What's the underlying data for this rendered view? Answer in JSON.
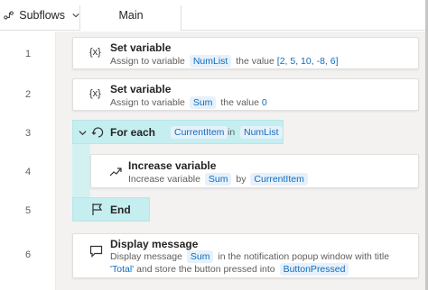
{
  "tabs": {
    "subflows_label": "Subflows",
    "main_label": "Main"
  },
  "line_numbers": [
    "1",
    "2",
    "3",
    "4",
    "5",
    "6"
  ],
  "actions": {
    "a1": {
      "icon": "{x}",
      "title": "Set variable",
      "desc_prefix": "Assign to variable",
      "variable": "NumList",
      "desc_mid": "the value",
      "value": "[2, 5, 10, -8, 6]"
    },
    "a2": {
      "icon": "{x}",
      "title": "Set variable",
      "desc_prefix": "Assign to variable",
      "variable": "Sum",
      "desc_mid": "the value",
      "value": "0"
    },
    "a3": {
      "title": "For each",
      "item": "CurrentItem",
      "kw_in": "in",
      "list": "NumList"
    },
    "a4": {
      "title": "Increase variable",
      "desc_prefix": "Increase variable",
      "variable": "Sum",
      "kw_by": "by",
      "by_value": "CurrentItem"
    },
    "a5": {
      "title": "End"
    },
    "a6": {
      "title": "Display message",
      "desc_prefix": "Display message",
      "message_var": "Sum",
      "desc_mid": "in the notification popup window with title",
      "title_value": "'Total'",
      "desc_suffix": "and store the button pressed into",
      "result_var": "ButtonPressed"
    }
  },
  "colors": {
    "accent": "#0f6cbd",
    "loop_fill": "#d4f1f2",
    "pill_bg": "#e6f1fb",
    "canvas_bg": "#f3f2f1"
  },
  "icons": [
    "subflows-icon",
    "chevron-down-icon",
    "variable-icon",
    "loop-icon",
    "increase-icon",
    "flag-icon",
    "message-icon",
    "collapse-chevron-icon"
  ]
}
